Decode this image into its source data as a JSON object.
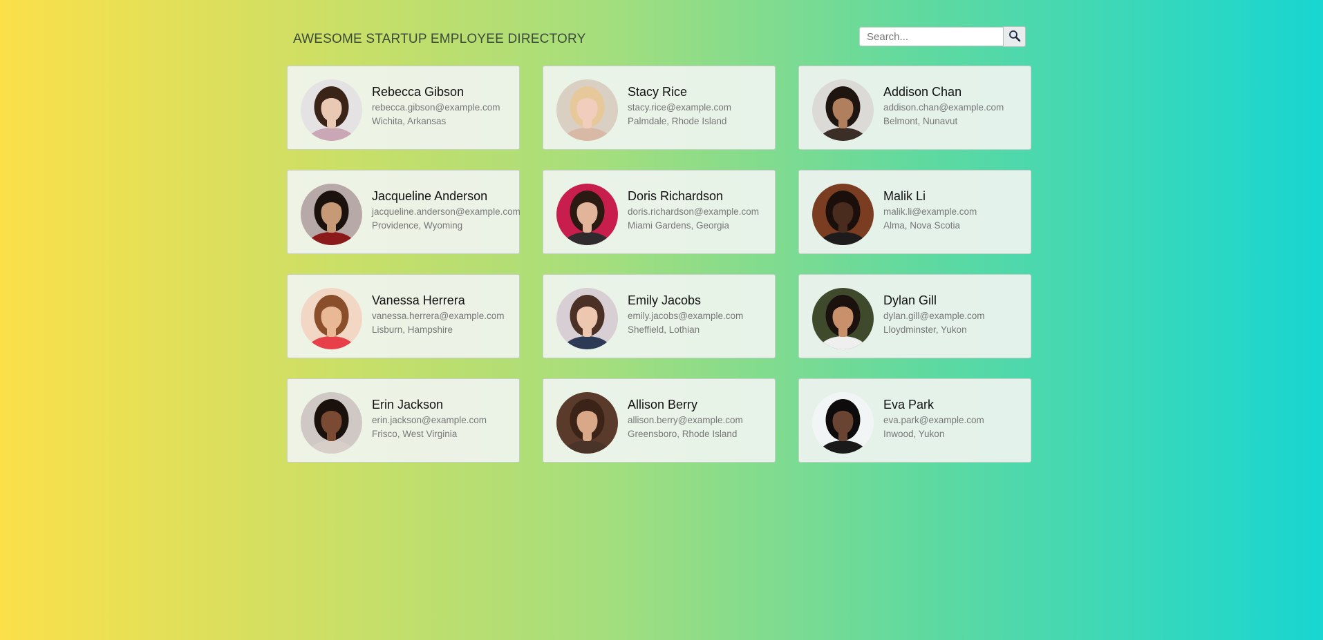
{
  "header": {
    "title": "AWESOME STARTUP EMPLOYEE DIRECTORY",
    "search_placeholder": "Search...",
    "search_icon": "magnifier-icon"
  },
  "colors": {
    "gradient_left": "#fbe04a",
    "gradient_mid": "#a6de7c",
    "gradient_right": "#18d6d1",
    "card_bg": "#f0f4f0",
    "name": "#111111",
    "detail": "#777777"
  },
  "employees": [
    {
      "name": "Rebecca Gibson",
      "email": "rebecca.gibson@example.com",
      "location": "Wichita, Arkansas",
      "skin": "#e9c9b4",
      "hair": "#3a2418",
      "bg": "#e5e2e4",
      "shirt": "#c9a7b5"
    },
    {
      "name": "Stacy Rice",
      "email": "stacy.rice@example.com",
      "location": "Palmdale, Rhode Island",
      "skin": "#f1cdbd",
      "hair": "#e7c89a",
      "bg": "#d9cfc2",
      "shirt": "#d8b9a5"
    },
    {
      "name": "Addison Chan",
      "email": "addison.chan@example.com",
      "location": "Belmont, Nunavut",
      "skin": "#b07f5e",
      "hair": "#1f1510",
      "bg": "#dcdad6",
      "shirt": "#3b2e26"
    },
    {
      "name": "Jacqueline Anderson",
      "email": "jacqueline.anderson@example.com",
      "location": "Providence, Wyoming",
      "skin": "#c79a77",
      "hair": "#1b120d",
      "bg": "#b8a9a9",
      "shirt": "#8b1a1a"
    },
    {
      "name": "Doris Richardson",
      "email": "doris.richardson@example.com",
      "location": "Miami Gardens, Georgia",
      "skin": "#e2b59a",
      "hair": "#2b1a12",
      "bg": "#c81e4e",
      "shirt": "#2e2a2e"
    },
    {
      "name": "Malik Li",
      "email": "malik.li@example.com",
      "location": "Alma, Nova Scotia",
      "skin": "#4a2c1e",
      "hair": "#1a0f0a",
      "bg": "#7a3d22",
      "shirt": "#1d1b1c"
    },
    {
      "name": "Vanessa Herrera",
      "email": "vanessa.herrera@example.com",
      "location": "Lisburn, Hampshire",
      "skin": "#e9b894",
      "hair": "#8a4f2a",
      "bg": "#f2d7c4",
      "shirt": "#e8404a"
    },
    {
      "name": "Emily Jacobs",
      "email": "emily.jacobs@example.com",
      "location": "Sheffield, Lothian",
      "skin": "#eec7b1",
      "hair": "#4a3025",
      "bg": "#d7cfd4",
      "shirt": "#2d3a55"
    },
    {
      "name": "Dylan Gill",
      "email": "dylan.gill@example.com",
      "location": "Lloydminster, Yukon",
      "skin": "#c8916c",
      "hair": "#1b120e",
      "bg": "#3f4a2c",
      "shirt": "#efefef"
    },
    {
      "name": "Erin Jackson",
      "email": "erin.jackson@example.com",
      "location": "Frisco, West Virginia",
      "skin": "#7a4a33",
      "hair": "#1b110c",
      "bg": "#cfc8c4",
      "shirt": "#d8cfc8"
    },
    {
      "name": "Allison Berry",
      "email": "allison.berry@example.com",
      "location": "Greensboro, Rhode Island",
      "skin": "#d9a889",
      "hair": "#3b2318",
      "bg": "#5a3a2a",
      "shirt": "#4a3328"
    },
    {
      "name": "Eva Park",
      "email": "eva.park@example.com",
      "location": "Inwood, Yukon",
      "skin": "#6a4433",
      "hair": "#0d0b0b",
      "bg": "#f2f5f6",
      "shirt": "#1a1a1a"
    }
  ]
}
